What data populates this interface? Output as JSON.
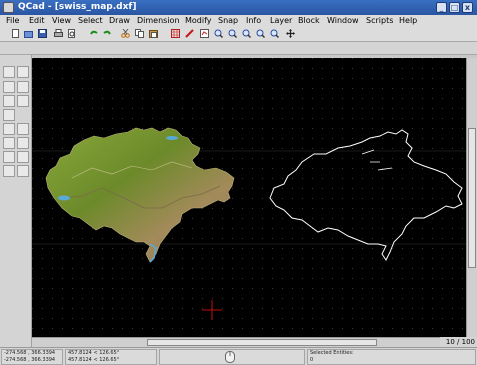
{
  "window": {
    "title": "QCad - [swiss_map.dxf]",
    "minimize": "_",
    "maximize": "□",
    "close": "x"
  },
  "menu": [
    "File",
    "Edit",
    "View",
    "Select",
    "Draw",
    "Dimension",
    "Modify",
    "Snap",
    "Info",
    "Layer",
    "Block",
    "Window",
    "Scripts",
    "Help"
  ],
  "canvas": {
    "page_indicator": "10 / 100"
  },
  "status": {
    "abs_coord_1": "-274.568 , 366.3394",
    "abs_coord_2": "-274.568 , 366.3394",
    "rel_coord_1": "457.8124 < 126.65°",
    "rel_coord_2": "457.8124 < 126.65°",
    "selected_label": "Selected Entities:",
    "selected_count": "0"
  },
  "colors": {
    "canvas_bg": "#000000",
    "crosshair": "#c01010",
    "outline": "#ffffff",
    "title_bg": "#2f5fb3"
  }
}
